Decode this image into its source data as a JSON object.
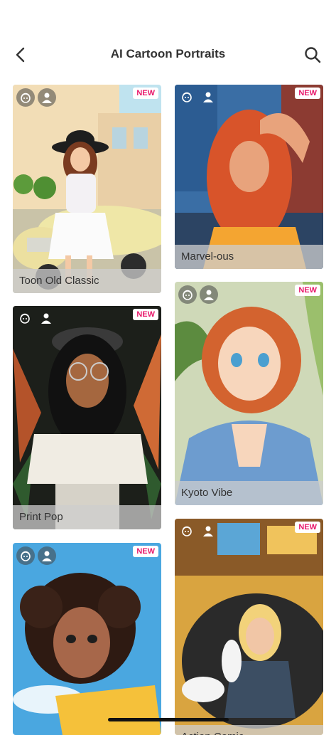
{
  "header": {
    "title": "AI Cartoon Portraits",
    "back_icon": "chevron-left-icon",
    "search_icon": "search-icon"
  },
  "badge_color": "#e8196b",
  "cards": [
    {
      "label": "Toon Old Classic",
      "badge": "NEW"
    },
    {
      "label": "Marvel-ous",
      "badge": "NEW"
    },
    {
      "label": "Print Pop",
      "badge": "NEW"
    },
    {
      "label": "Kyoto Vibe",
      "badge": "NEW"
    },
    {
      "label": "",
      "badge": "NEW"
    },
    {
      "label": "Action Comic",
      "badge": "NEW"
    }
  ]
}
